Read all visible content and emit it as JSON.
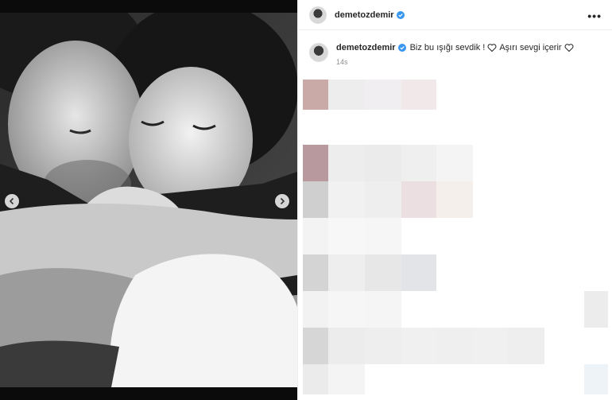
{
  "header": {
    "username": "demetozdemir",
    "verified": true,
    "more_label": "•••"
  },
  "caption": {
    "username": "demetozdemir",
    "text_part1": "Biz bu ışığı sevdik !",
    "text_part2": "Aşırı sevgi içerir",
    "timestamp": "14s"
  },
  "carousel": {
    "prev_icon": "chevron-left-icon",
    "next_icon": "chevron-right-icon"
  },
  "colors": {
    "verified": "#3897f0",
    "text": "#262626",
    "muted": "#8e8e8e"
  }
}
